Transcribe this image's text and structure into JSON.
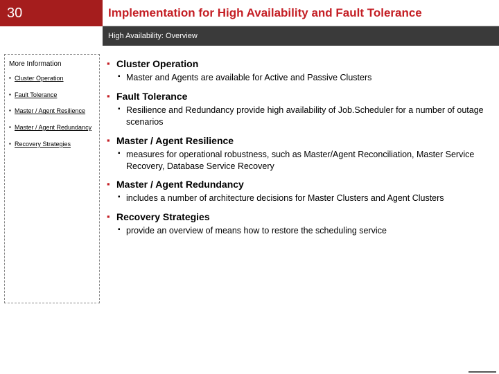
{
  "slideNumber": "30",
  "title": "Implementation for High Availability and Fault Tolerance",
  "subtitle": "High Availability: Overview",
  "sidebar": {
    "heading": "More Information",
    "items": [
      "Cluster Operation",
      "Fault Tolerance",
      "Master / Agent Resilience",
      "Master / Agent Redundancy",
      "Recovery Strategies"
    ]
  },
  "sections": [
    {
      "head": "Cluster Operation",
      "body": "Master and Agents are available for Active and Passive Clusters"
    },
    {
      "head": "Fault Tolerance",
      "body": "Resilience and Redundancy provide high availability of Job.Scheduler for a number of outage scenarios"
    },
    {
      "head": "Master / Agent Resilience",
      "body": "measures for operational robustness, such as Master/Agent Reconciliation, Master Service Recovery, Database Service Recovery"
    },
    {
      "head": "Master / Agent Redundancy",
      "body": "includes a number of architecture decisions for Master Clusters and Agent Clusters"
    },
    {
      "head": "Recovery Strategies",
      "body": "provide an overview of means how to restore the scheduling service"
    }
  ]
}
